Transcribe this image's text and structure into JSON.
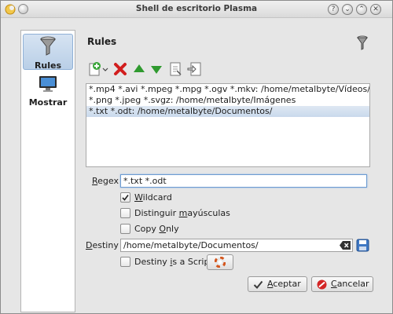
{
  "window": {
    "title": "Shell de escritorio Plasma",
    "buttons": {
      "help": "?",
      "minimize": "⌄",
      "maximize": "⌃",
      "close": "✕"
    }
  },
  "sidebar": {
    "items": [
      {
        "label": "Rules",
        "icon": "funnel-icon",
        "active": true
      },
      {
        "label": "Mostrar",
        "icon": "monitor-icon",
        "active": false
      }
    ]
  },
  "main": {
    "heading": "Rules",
    "heading_icon": "funnel-icon",
    "toolbar": [
      "add-rule-icon",
      "remove-rule-icon",
      "move-up-icon",
      "move-down-icon",
      "import-icon",
      "export-icon"
    ],
    "rules": [
      "*.mp4 *.avi *.mpeg *.mpg *.ogv *.mkv: /home/metalbyte/Vídeos/",
      "*.png *.jpeg *.svgz: /home/metalbyte/Imágenes",
      "*.txt *.odt: /home/metalbyte/Documentos/"
    ],
    "selected_rule_index": 2
  },
  "form": {
    "regex_label_first": "R",
    "regex_label_rest": "egex",
    "regex_value": "*.txt *.odt",
    "wildcard_u": "W",
    "wildcard_rest": "ildcard",
    "wildcard_checked": true,
    "case_pre": "Distinguir ",
    "case_u": "m",
    "case_rest": "ayúsculas",
    "case_checked": false,
    "copy_pre": "Copy ",
    "copy_u": "O",
    "copy_rest": "nly",
    "copy_checked": false,
    "destiny_label_first": "D",
    "destiny_label_rest": "estiny",
    "destiny_value": "/home/metalbyte/Documentos/",
    "script_pre": "Destiny ",
    "script_u": "i",
    "script_rest": "s a Script",
    "script_checked": false
  },
  "footer": {
    "accept_u": "A",
    "accept_rest": "ceptar",
    "cancel_u": "C",
    "cancel_rest": "ancelar"
  },
  "colors": {
    "accent": "#6b9bd1",
    "selection": "#c9d9ec",
    "remove_red": "#d21e1e",
    "arrow_green": "#2f9a2f"
  }
}
